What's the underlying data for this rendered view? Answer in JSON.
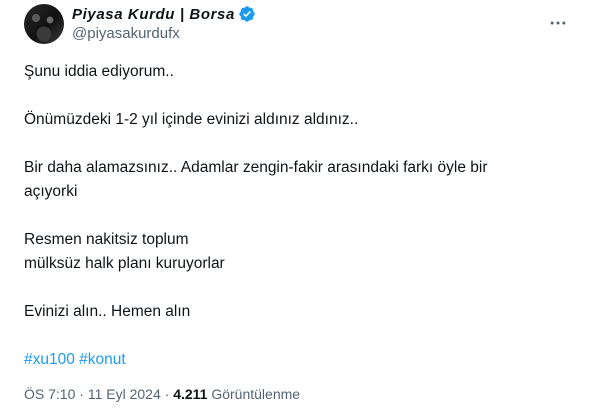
{
  "author": {
    "display_name": "Piyasa Kurdu | Borsa",
    "handle": "@piyasakurdufx",
    "verified_icon": "verified-badge-icon",
    "verified_color": "#1d9bf0"
  },
  "more_icon": "more-options-icon",
  "tweet": {
    "lines": [
      "Şunu iddia ediyorum..",
      "Önümüzdeki 1-2 yıl içinde evinizi aldınız aldınız..",
      "Bir daha alamazsınız.. Adamlar zengin-fakir arasındaki farkı öyle bir",
      "açıyorki",
      "Resmen nakitsiz toplum",
      "mülksüz halk planı kuruyorlar",
      "Evinizi alın.. Hemen alın"
    ],
    "hashtags": [
      "#xu100",
      "#konut"
    ],
    "hashtag_color": "#1d9bf0"
  },
  "meta": {
    "time": "ÖS 7:10",
    "separator": "·",
    "date": "11 Eyl 2024",
    "views_count": "4.211",
    "views_label": "Görüntülenme"
  }
}
